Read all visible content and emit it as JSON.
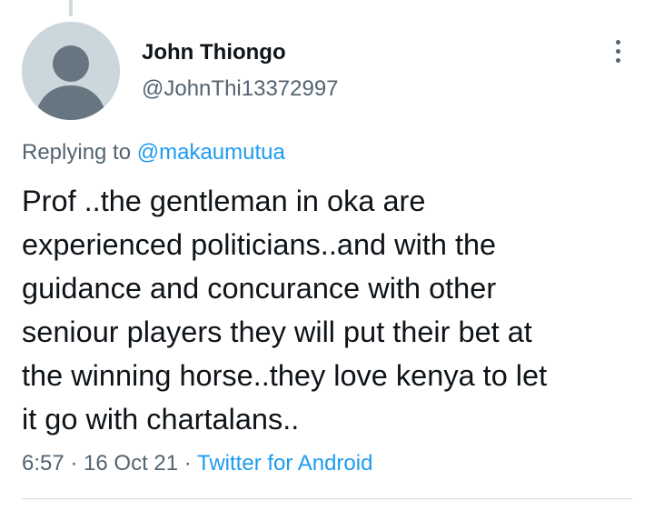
{
  "tweet": {
    "author": {
      "display_name": "John Thiongo",
      "handle": "@JohnThi13372997",
      "avatar_icon": "default-profile-avatar"
    },
    "more_icon": "more-vertical-icon",
    "replying_to": {
      "prefix": "Replying to",
      "mention": "@makaumutua"
    },
    "text": "Prof ..the gentleman in oka are\nexperienced politicians..and with the\nguidance and concurance with other\nseniour players they will put their bet at\nthe winning horse..they love kenya to let\nit go with chartalans..",
    "meta": {
      "time": "6:57",
      "separator": " · ",
      "date": "16 Oct 21",
      "source": "Twitter for Android"
    }
  },
  "colors": {
    "primary_text": "#0f1419",
    "secondary_text": "#536471",
    "link": "#1d9bf0",
    "avatar_bg": "#ccd6dd",
    "avatar_figure": "#66757f",
    "divider": "#cfd9de"
  }
}
